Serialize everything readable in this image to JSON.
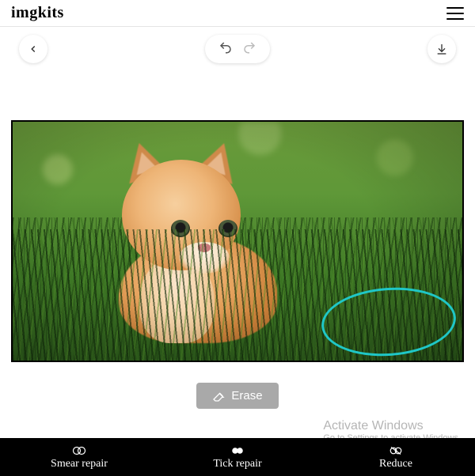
{
  "header": {
    "logo": "imgkits"
  },
  "toolbar": {
    "back_label": "Back",
    "undo_label": "Undo",
    "redo_label": "Redo",
    "download_label": "Download"
  },
  "actions": {
    "erase_label": "Erase"
  },
  "tabs": [
    {
      "label": "Smear repair"
    },
    {
      "label": "Tick repair"
    },
    {
      "label": "Reduce"
    }
  ],
  "watermark": {
    "line1": "Activate Windows",
    "line2": "Go to Settings to activate Windows."
  }
}
